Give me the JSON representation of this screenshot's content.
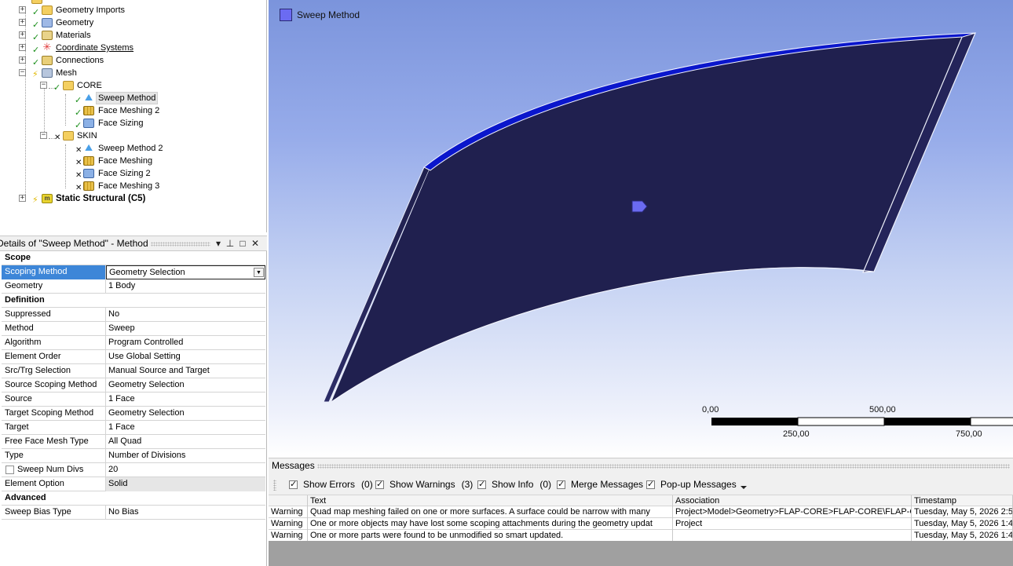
{
  "tree": {
    "items": [
      {
        "label": "Geometry Imports",
        "icon": "geometry-imports-icon",
        "status": "ok"
      },
      {
        "label": "Geometry",
        "icon": "geometry-icon",
        "status": "ok"
      },
      {
        "label": "Materials",
        "icon": "materials-icon",
        "status": "ok"
      },
      {
        "label": "Coordinate Systems",
        "icon": "coordinate-systems-icon",
        "status": "ok"
      },
      {
        "label": "Connections",
        "icon": "connections-icon",
        "status": "ok"
      },
      {
        "label": "Mesh",
        "icon": "mesh-icon",
        "status": "pending"
      },
      {
        "label": "CORE",
        "icon": "folder-icon",
        "status": "ok"
      },
      {
        "label": "Sweep Method",
        "icon": "sweep-method-icon",
        "status": "ok"
      },
      {
        "label": "Face Meshing 2",
        "icon": "face-meshing-icon",
        "status": "ok"
      },
      {
        "label": "Face Sizing",
        "icon": "face-sizing-icon",
        "status": "ok"
      },
      {
        "label": "SKIN",
        "icon": "folder-icon",
        "status": "error"
      },
      {
        "label": "Sweep Method 2",
        "icon": "sweep-method-icon",
        "status": "error"
      },
      {
        "label": "Face Meshing",
        "icon": "face-meshing-icon",
        "status": "error"
      },
      {
        "label": "Face Sizing 2",
        "icon": "face-sizing-icon",
        "status": "error"
      },
      {
        "label": "Face Meshing 3",
        "icon": "face-meshing-icon",
        "status": "error"
      },
      {
        "label": "Static Structural (C5)",
        "icon": "static-structural-icon",
        "status": "pending"
      }
    ],
    "expand_plus": "+",
    "expand_minus": "−",
    "check_glyph": "✓",
    "error_glyph": "✕",
    "bolt_glyph": "⚡"
  },
  "details": {
    "title": "Details of \"Sweep Method\" - Method",
    "title_buttons": {
      "dropdown": "▾",
      "pin": "⊥",
      "restore": "□",
      "close": "✕"
    },
    "sections": [
      {
        "header": "Scope",
        "rows": [
          {
            "key": "Scoping Method",
            "value": "Geometry Selection"
          },
          {
            "key": "Geometry",
            "value": "1 Body"
          }
        ]
      },
      {
        "header": "Definition",
        "rows": [
          {
            "key": "Suppressed",
            "value": "No"
          },
          {
            "key": "Method",
            "value": "Sweep"
          },
          {
            "key": "Algorithm",
            "value": "Program Controlled"
          },
          {
            "key": "Element Order",
            "value": "Use Global Setting"
          },
          {
            "key": "Src/Trg Selection",
            "value": "Manual Source and Target"
          },
          {
            "key": "Source Scoping Method",
            "value": "Geometry Selection"
          },
          {
            "key": "Source",
            "value": "1 Face"
          },
          {
            "key": "Target Scoping Method",
            "value": "Geometry Selection"
          },
          {
            "key": "Target",
            "value": "1 Face"
          },
          {
            "key": "Free Face Mesh Type",
            "value": "All Quad"
          },
          {
            "key": "Type",
            "value": "Number of Divisions"
          },
          {
            "key": "Sweep Num Divs",
            "value": "20"
          },
          {
            "key": "Element Option",
            "value": "Solid"
          }
        ]
      },
      {
        "header": "Advanced",
        "rows": [
          {
            "key": "Sweep Bias Type",
            "value": "No Bias"
          }
        ]
      }
    ],
    "dropdown_arrow": "▼"
  },
  "viewport": {
    "legend_label": "Sweep Method",
    "scale": {
      "t0": "0,00",
      "t1": "250,00",
      "t2": "500,00",
      "t3": "750,00"
    },
    "colors": {
      "face": "#1f1f4e",
      "edge_highlight": "#0a16cc",
      "marker": "#6b6bf2"
    }
  },
  "messages": {
    "title": "Messages",
    "options": [
      {
        "label": "Show Errors",
        "count": "(0)"
      },
      {
        "label": "Show Warnings",
        "count": "(3)"
      },
      {
        "label": "Show Info",
        "count": "(0)"
      },
      {
        "label": "Merge Messages",
        "count": ""
      },
      {
        "label": "Pop-up Messages",
        "count": ""
      }
    ],
    "columns": [
      "",
      "Text",
      "Association",
      "Timestamp"
    ],
    "rows": [
      {
        "type": "Warning",
        "text": "Quad map meshing failed on one or more surfaces. A surface could be narrow with many",
        "association": "Project>Model>Geometry>FLAP-CORE>FLAP-CORE\\FLAP-C",
        "timestamp": "Tuesday, May 5, 2026 2:5"
      },
      {
        "type": "Warning",
        "text": "One or more objects may have lost some scoping attachments during the geometry updat",
        "association": "Project",
        "timestamp": "Tuesday, May 5, 2026 1:4"
      },
      {
        "type": "Warning",
        "text": "One or more parts were found to be unmodified so smart updated.",
        "association": "",
        "timestamp": "Tuesday, May 5, 2026 1:4"
      }
    ]
  }
}
